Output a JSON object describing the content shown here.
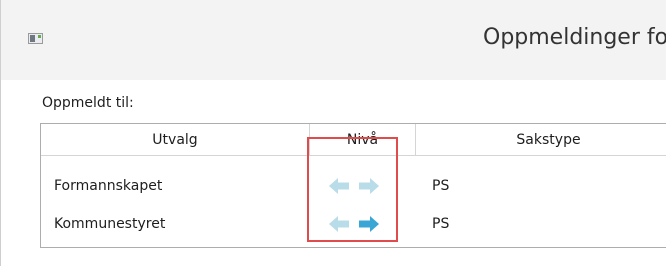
{
  "window": {
    "title": "Oppmeldinger fo"
  },
  "icons": {
    "app": "app-window-icon",
    "level_down": "arrow-left-icon",
    "level_up": "arrow-right-icon"
  },
  "section": {
    "label": "Oppmeldt til:"
  },
  "grid": {
    "columns": [
      "Utvalg",
      "Nivå",
      "Sakstype"
    ],
    "rows": [
      {
        "utvalg": "Formannskapet",
        "sakstype": "PS",
        "left_enabled": false,
        "right_enabled": false
      },
      {
        "utvalg": "Kommunestyret",
        "sakstype": "PS",
        "left_enabled": false,
        "right_enabled": true
      }
    ]
  },
  "colors": {
    "arrow_disabled": "#b9dce9",
    "arrow_enabled": "#3aa6d6",
    "highlight": "#e04b4b"
  }
}
